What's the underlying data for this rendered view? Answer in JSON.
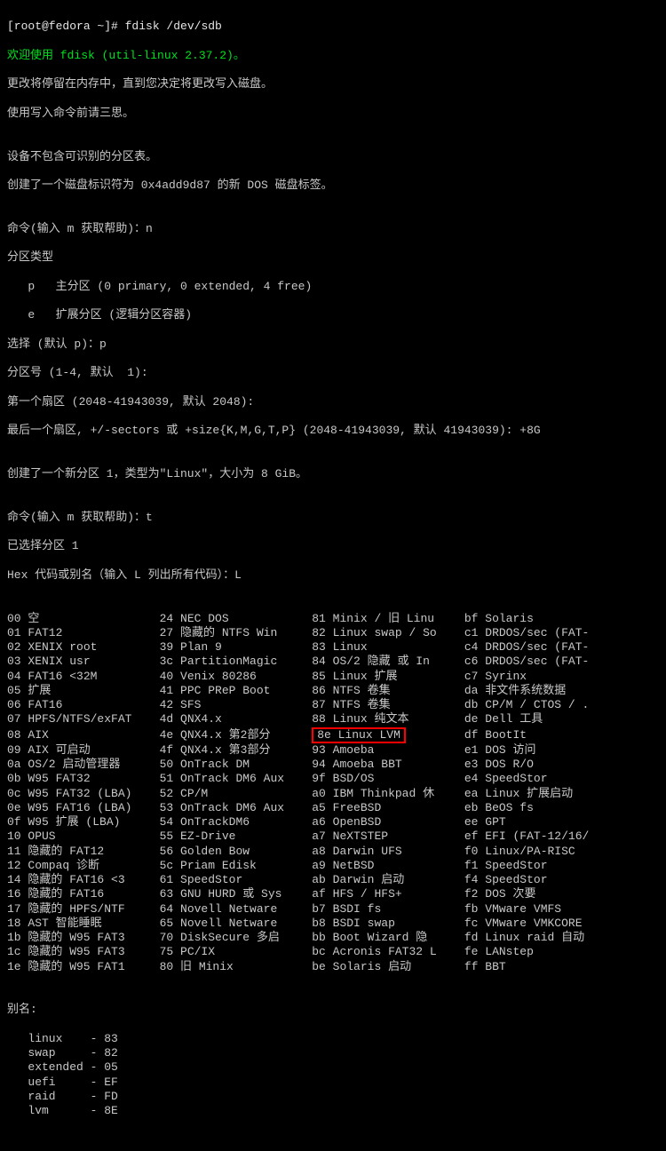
{
  "prompt": "[root@fedora ~]# ",
  "cmd": "fdisk /dev/sdb",
  "welcome": "欢迎使用 fdisk (util-linux 2.37.2)。",
  "note1": "更改将停留在内存中，直到您决定将更改写入磁盘。",
  "note2": "使用写入命令前请三思。",
  "blank": "",
  "warn1": "设备不包含可识别的分区表。",
  "warn2": "创建了一个磁盘标识符为 0x4add9d87 的新 DOS 磁盘标签。",
  "cmdHelp1": "命令(输入 m 获取帮助)：n",
  "ptTitle": "分区类型",
  "ptP": "   p   主分区 (0 primary, 0 extended, 4 free)",
  "ptE": "   e   扩展分区 (逻辑分区容器)",
  "selP": "选择 (默认 p)：p",
  "partNo": "分区号 (1-4, 默认  1):",
  "firstSector": "第一个扇区 (2048-41943039, 默认 2048):",
  "lastSector": "最后一个扇区, +/-sectors 或 +size{K,M,G,T,P} (2048-41943039, 默认 41943039): +8G",
  "created": "创建了一个新分区 1，类型为\"Linux\"，大小为 8 GiB。",
  "cmdHelp2": "命令(输入 m 获取帮助)：t",
  "selected": "已选择分区 1",
  "hexPrompt": "Hex 代码或别名（输入 L 列出所有代码）：L",
  "highlight": "8e Linux LVM",
  "table": [
    [
      "00 空",
      "24 NEC DOS",
      "81 Minix / 旧 Linu",
      "bf Solaris"
    ],
    [
      "01 FAT12",
      "27 隐藏的 NTFS Win",
      "82 Linux swap / So",
      "c1 DRDOS/sec (FAT-"
    ],
    [
      "02 XENIX root",
      "39 Plan 9",
      "83 Linux",
      "c4 DRDOS/sec (FAT-"
    ],
    [
      "03 XENIX usr",
      "3c PartitionMagic",
      "84 OS/2 隐藏 或 In",
      "c6 DRDOS/sec (FAT-"
    ],
    [
      "04 FAT16 <32M",
      "40 Venix 80286",
      "85 Linux 扩展",
      "c7 Syrinx"
    ],
    [
      "05 扩展",
      "41 PPC PReP Boot",
      "86 NTFS 卷集",
      "da 非文件系统数据"
    ],
    [
      "06 FAT16",
      "42 SFS",
      "87 NTFS 卷集",
      "db CP/M / CTOS / ."
    ],
    [
      "07 HPFS/NTFS/exFAT",
      "4d QNX4.x",
      "88 Linux 纯文本",
      "de Dell 工具"
    ],
    [
      "08 AIX",
      "4e QNX4.x 第2部分",
      "__HL__",
      "df BootIt"
    ],
    [
      "09 AIX 可启动",
      "4f QNX4.x 第3部分",
      "93 Amoeba",
      "e1 DOS 访问"
    ],
    [
      "0a OS/2 启动管理器",
      "50 OnTrack DM",
      "94 Amoeba BBT",
      "e3 DOS R/O"
    ],
    [
      "0b W95 FAT32",
      "51 OnTrack DM6 Aux",
      "9f BSD/OS",
      "e4 SpeedStor"
    ],
    [
      "0c W95 FAT32 (LBA)",
      "52 CP/M",
      "a0 IBM Thinkpad 休",
      "ea Linux 扩展启动"
    ],
    [
      "0e W95 FAT16 (LBA)",
      "53 OnTrack DM6 Aux",
      "a5 FreeBSD",
      "eb BeOS fs"
    ],
    [
      "0f W95 扩展 (LBA)",
      "54 OnTrackDM6",
      "a6 OpenBSD",
      "ee GPT"
    ],
    [
      "10 OPUS",
      "55 EZ-Drive",
      "a7 NeXTSTEP",
      "ef EFI (FAT-12/16/"
    ],
    [
      "11 隐藏的 FAT12",
      "56 Golden Bow",
      "a8 Darwin UFS",
      "f0 Linux/PA-RISC"
    ],
    [
      "12 Compaq 诊断",
      "5c Priam Edisk",
      "a9 NetBSD",
      "f1 SpeedStor"
    ],
    [
      "14 隐藏的 FAT16 <3",
      "61 SpeedStor",
      "ab Darwin 启动",
      "f4 SpeedStor"
    ],
    [
      "16 隐藏的 FAT16",
      "63 GNU HURD 或 Sys",
      "af HFS / HFS+",
      "f2 DOS 次要"
    ],
    [
      "17 隐藏的 HPFS/NTF",
      "64 Novell Netware",
      "b7 BSDI fs",
      "fb VMware VMFS"
    ],
    [
      "18 AST 智能睡眠",
      "65 Novell Netware",
      "b8 BSDI swap",
      "fc VMware VMKCORE"
    ],
    [
      "1b 隐藏的 W95 FAT3",
      "70 DiskSecure 多启",
      "bb Boot Wizard 隐",
      "fd Linux raid 自动"
    ],
    [
      "1c 隐藏的 W95 FAT3",
      "75 PC/IX",
      "bc Acronis FAT32 L",
      "fe LANstep"
    ],
    [
      "1e 隐藏的 W95 FAT1",
      "80 旧 Minix",
      "be Solaris 启动",
      "ff BBT"
    ]
  ],
  "aliasesTitle": "别名:",
  "aliases": [
    {
      "name": "   linux",
      "code": "83"
    },
    {
      "name": "   swap",
      "code": "82"
    },
    {
      "name": "   extended",
      "code": "05"
    },
    {
      "name": "   uefi",
      "code": "EF"
    },
    {
      "name": "   raid",
      "code": "FD"
    },
    {
      "name": "   lvm",
      "code": "8E"
    }
  ]
}
